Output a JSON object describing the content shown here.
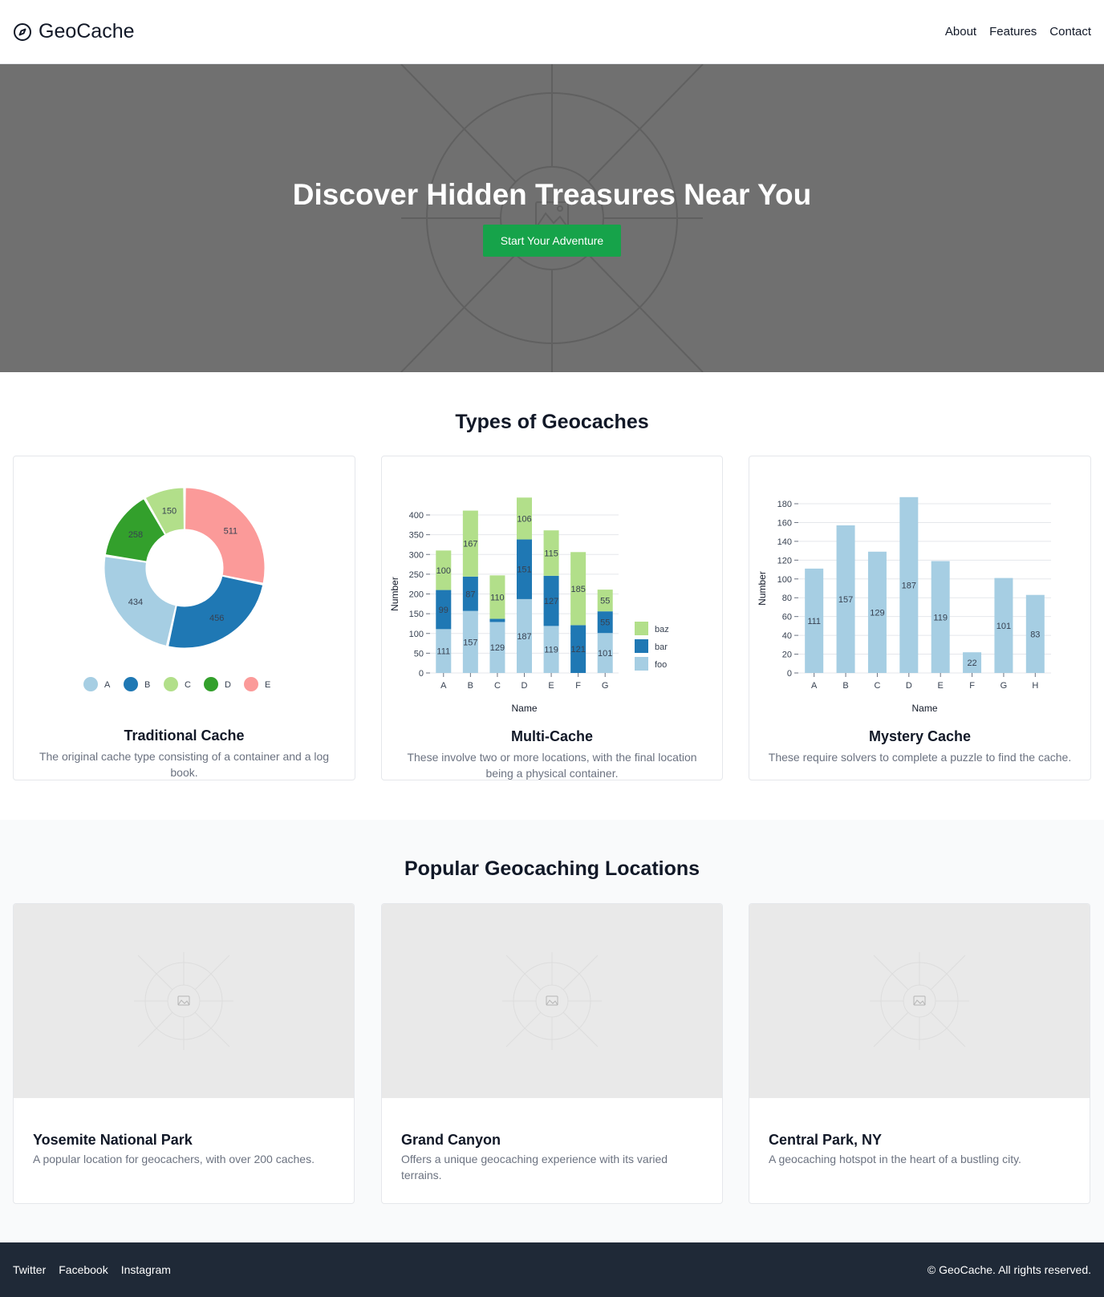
{
  "header": {
    "brand": "GeoCache",
    "brand_icon": "compass-icon",
    "nav": [
      "About",
      "Features",
      "Contact"
    ]
  },
  "hero": {
    "title": "Discover Hidden Treasures Near You",
    "button": "Start Your Adventure",
    "button_color": "#16a34a",
    "background_icon": "image-placeholder-icon"
  },
  "types_section": {
    "title": "Types of Geocaches",
    "cards": [
      {
        "title": "Traditional Cache",
        "description": "The original cache type consisting of a container and a log book."
      },
      {
        "title": "Multi-Cache",
        "description": "These involve two or more locations, with the final location being a physical container."
      },
      {
        "title": "Mystery Cache",
        "description": "These require solvers to complete a puzzle to find the cache."
      }
    ]
  },
  "locations_section": {
    "title": "Popular Geocaching Locations",
    "cards": [
      {
        "title": "Yosemite National Park",
        "description": "A popular location for geocachers, with over 200 caches.",
        "image_icon": "image-placeholder-icon"
      },
      {
        "title": "Grand Canyon",
        "description": "Offers a unique geocaching experience with its varied terrains.",
        "image_icon": "image-placeholder-icon"
      },
      {
        "title": "Central Park, NY",
        "description": "A geocaching hotspot in the heart of a bustling city.",
        "image_icon": "image-placeholder-icon"
      }
    ]
  },
  "footer": {
    "links": [
      "Twitter",
      "Facebook",
      "Instagram"
    ],
    "copyright": "© GeoCache. All rights reserved."
  },
  "chart_data": [
    {
      "type": "pie",
      "donut": true,
      "categories": [
        "A",
        "B",
        "C",
        "D",
        "E"
      ],
      "values": [
        434,
        456,
        150,
        258,
        511
      ],
      "colors": [
        "#a6cee3",
        "#1f78b4",
        "#b2df8a",
        "#33a02c",
        "#fb9a99"
      ],
      "legend": "bottom"
    },
    {
      "type": "bar",
      "stacked": true,
      "categories": [
        "A",
        "B",
        "C",
        "D",
        "E",
        "F",
        "G"
      ],
      "series": [
        {
          "name": "foo",
          "values": [
            111,
            157,
            129,
            187,
            119,
            0,
            101
          ],
          "color": "#a6cee3"
        },
        {
          "name": "bar",
          "values": [
            99,
            87,
            8,
            151,
            127,
            121,
            55
          ],
          "color": "#1f78b4"
        },
        {
          "name": "baz",
          "values": [
            100,
            167,
            110,
            106,
            115,
            185,
            55
          ],
          "color": "#b2df8a"
        }
      ],
      "labels": {
        "foo": [
          "111",
          "157",
          "129",
          "187",
          "119",
          "",
          "101"
        ],
        "bar": [
          "99",
          "87",
          "",
          "151",
          "127",
          "121",
          "55"
        ],
        "baz": [
          "100",
          "167",
          "110",
          "106",
          "115",
          "185",
          "55"
        ]
      },
      "xlabel": "Name",
      "ylabel": "Number",
      "ylim": [
        0,
        400
      ],
      "yticks": [
        0,
        50,
        100,
        150,
        200,
        250,
        300,
        350,
        400
      ],
      "grid": true,
      "legend": "right"
    },
    {
      "type": "bar",
      "categories": [
        "A",
        "B",
        "C",
        "D",
        "E",
        "F",
        "G",
        "H"
      ],
      "values": [
        111,
        157,
        129,
        187,
        119,
        22,
        101,
        83
      ],
      "color": "#a6cee3",
      "xlabel": "Name",
      "ylabel": "Number",
      "ylim": [
        0,
        180
      ],
      "yticks": [
        0,
        20,
        40,
        60,
        80,
        100,
        120,
        140,
        160,
        180
      ],
      "grid": true
    }
  ]
}
